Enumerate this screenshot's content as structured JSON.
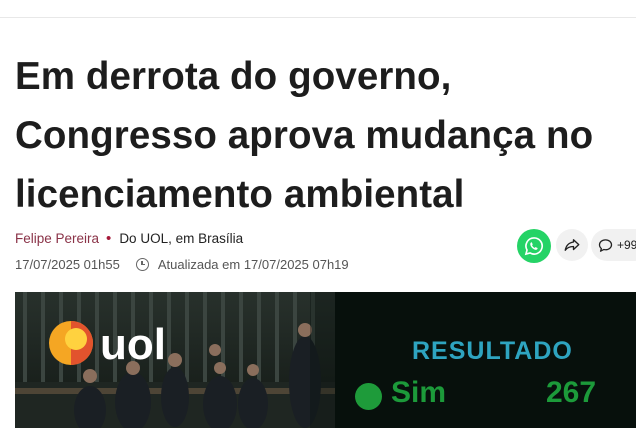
{
  "article": {
    "headline_lines": [
      "Em derrota do governo,",
      "Congresso aprova mudança no",
      "licenciamento ambiental"
    ],
    "author": "Felipe Pereira",
    "separator": "•",
    "source": "Do UOL, em Brasília",
    "published": "17/07/2025 01h55",
    "updated": "Atualizada em 17/07/2025 07h19"
  },
  "actions": {
    "whatsapp_icon": "whatsapp-icon",
    "share_icon": "share-arrow-icon",
    "comments_icon": "speech-bubble-icon",
    "comments_count": "+99"
  },
  "image": {
    "logo_text": "uol",
    "panel_title": "RESULTADO",
    "vote_label": "Sim",
    "vote_count": "267"
  },
  "colors": {
    "author": "#8a3247",
    "bullet": "#a6193a",
    "whatsapp": "#25d366",
    "panel_title": "#2ea4c0",
    "vote_green": "#1c9a3a",
    "logo_orange": "#f5a623"
  }
}
